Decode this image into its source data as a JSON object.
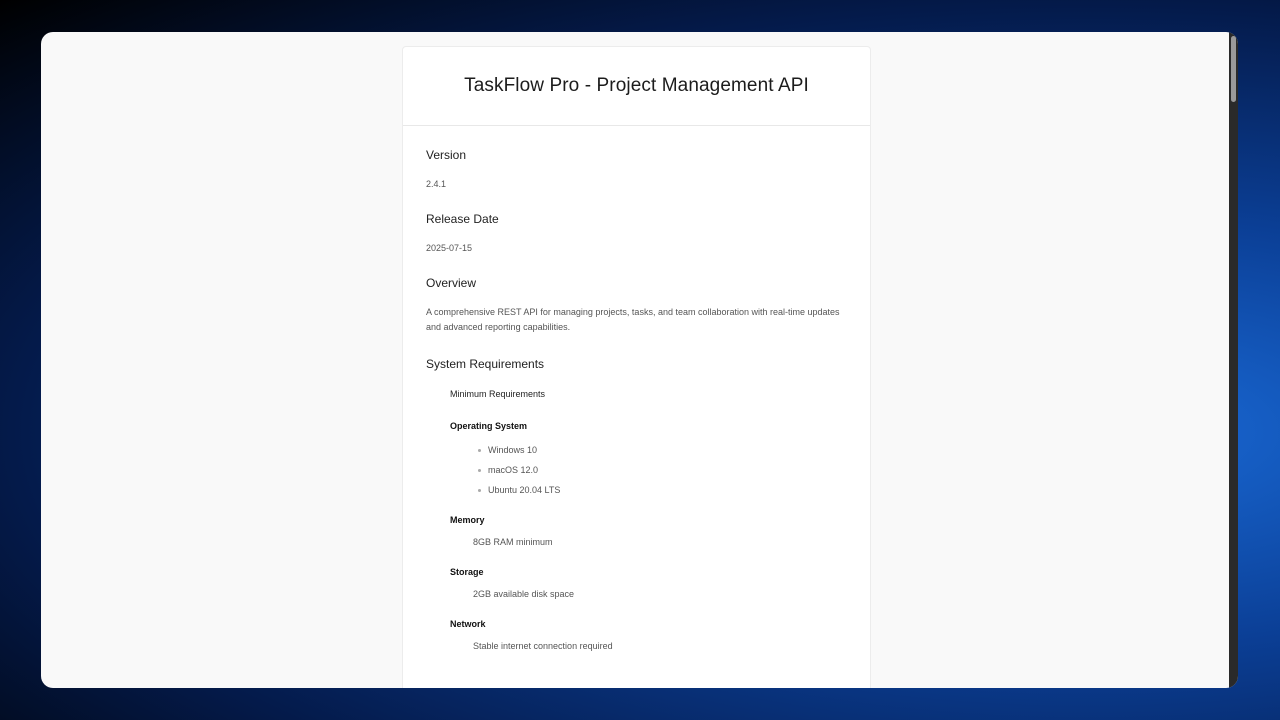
{
  "header": {
    "title": "TaskFlow Pro - Project Management API"
  },
  "version": {
    "label": "Version",
    "value": "2.4.1"
  },
  "release": {
    "label": "Release Date",
    "value": "2025-07-15"
  },
  "overview": {
    "label": "Overview",
    "value": "A comprehensive REST API for managing projects, tasks, and team collaboration with real-time updates and advanced reporting capabilities."
  },
  "requirements": {
    "label": "System Requirements",
    "heading": "Minimum Requirements",
    "os": {
      "label": "Operating System",
      "items": [
        "Windows 10",
        "macOS 12.0",
        "Ubuntu 20.04 LTS"
      ]
    },
    "memory": {
      "label": "Memory",
      "value": "8GB RAM minimum"
    },
    "storage": {
      "label": "Storage",
      "value": "2GB available disk space"
    },
    "network": {
      "label": "Network",
      "value": "Stable internet connection required"
    }
  }
}
